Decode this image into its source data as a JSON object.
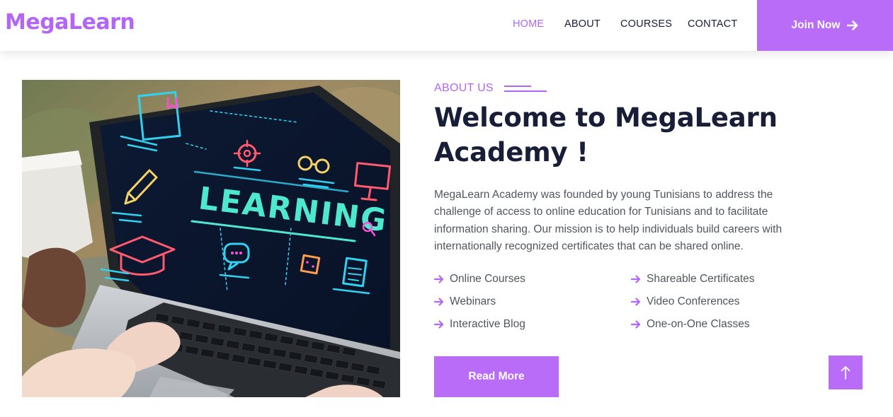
{
  "brand": {
    "name": "MegaLearn"
  },
  "nav": {
    "items": [
      {
        "label": "HOME",
        "active": true
      },
      {
        "label": "ABOUT",
        "active": false
      },
      {
        "label": "COURSES",
        "active": false
      },
      {
        "label": "CONTACT",
        "active": false
      }
    ],
    "join_label": "Join Now",
    "join_icon": "arrow-right-icon"
  },
  "hero": {
    "image_subject": "laptop with neon learning icons",
    "screen_text": "LEARNING"
  },
  "about": {
    "eyebrow": "ABOUT US",
    "title_line1": "Welcome to MegaLearn",
    "title_line2": "Academy !",
    "description": "MegaLearn Academy was founded by young Tunisians to address the challenge of access to online education for Tunisians and to facilitate information sharing. Our mission is to help individuals build careers with internationally recognized certificates that can be shared online.",
    "features": [
      "Online Courses",
      "Shareable Certificates",
      "Webinars",
      "Video Conferences",
      "Interactive Blog",
      "One-on-One Classes"
    ],
    "read_more_label": "Read More"
  },
  "back_to_top": {
    "icon": "arrow-up-icon"
  },
  "colors": {
    "accent": "#b86cf7",
    "heading": "#181d38",
    "body_text": "#52565b",
    "background": "#ffffff"
  }
}
